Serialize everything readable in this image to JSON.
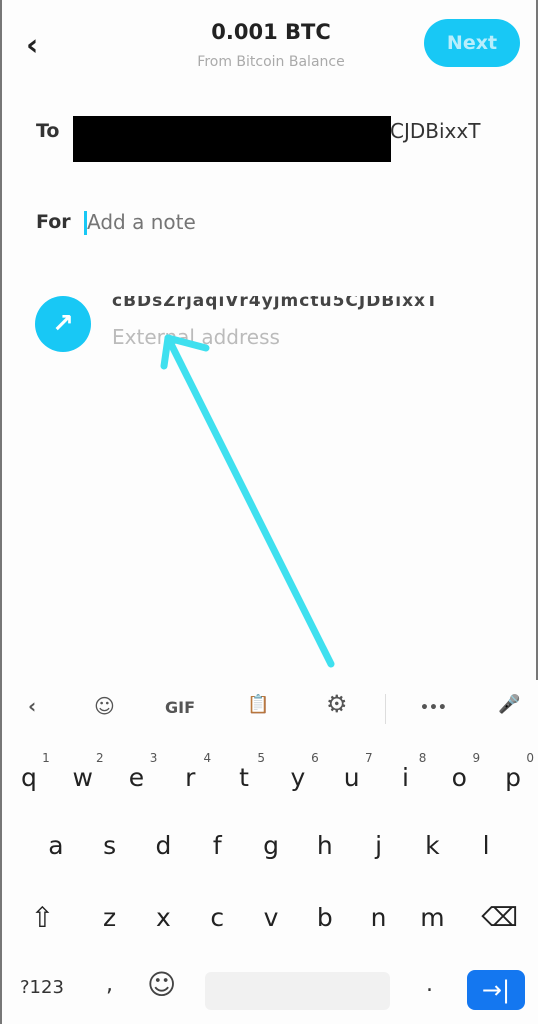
{
  "header": {
    "back_icon": "‹",
    "amount": "0.001 BTC",
    "source": "From Bitcoin Balance",
    "next_label": "Next"
  },
  "recipient": {
    "label": "To",
    "value_visible": "CJDBixxT"
  },
  "note": {
    "label": "For",
    "placeholder": "Add a note"
  },
  "suggestion": {
    "icon": "↗",
    "address": "cBDsZrjaqiVr4yjmctu5CJDBixxT",
    "subtitle": "External address"
  },
  "keyboard": {
    "toolbar": {
      "collapse": "‹",
      "sticker": "☺",
      "gif": "GIF",
      "clipboard": "📋",
      "settings": "⚙",
      "more": "•••",
      "mic": "🎤"
    },
    "row1": [
      "q",
      "w",
      "e",
      "r",
      "t",
      "y",
      "u",
      "i",
      "o",
      "p"
    ],
    "row1_hints": [
      "1",
      "2",
      "3",
      "4",
      "5",
      "6",
      "7",
      "8",
      "9",
      "0"
    ],
    "row2": [
      "a",
      "s",
      "d",
      "f",
      "g",
      "h",
      "j",
      "k",
      "l"
    ],
    "row3": [
      "z",
      "x",
      "c",
      "v",
      "b",
      "n",
      "m"
    ],
    "shift": "⇧",
    "backspace": "⌫",
    "symbols": "?123",
    "comma": ",",
    "emoji": "☺",
    "period": ".",
    "enter": "→|"
  },
  "colors": {
    "accent": "#18c8f5",
    "enter": "#1477f0",
    "annotation_arrow": "#3fe0ef"
  }
}
